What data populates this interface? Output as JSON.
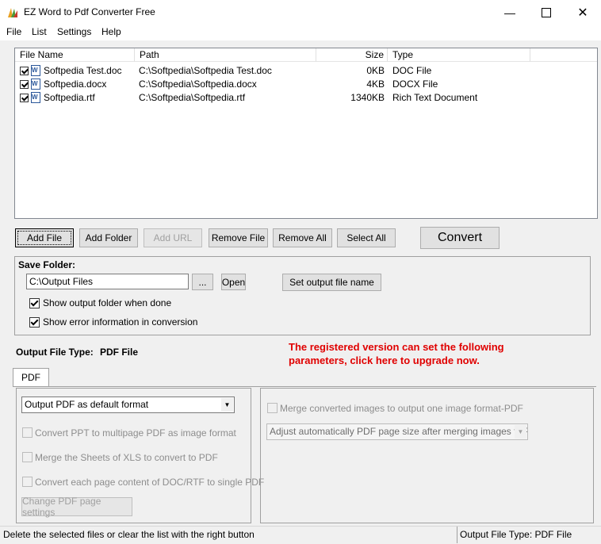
{
  "window": {
    "title": "EZ Word to Pdf Converter Free"
  },
  "menu": [
    "File",
    "List",
    "Settings",
    "Help"
  ],
  "file_list": {
    "columns": [
      "File Name",
      "Path",
      "Size",
      "Type"
    ],
    "rows": [
      {
        "name": "Softpedia Test.doc",
        "path": "C:\\Softpedia\\Softpedia Test.doc",
        "size": "0KB",
        "type": "DOC File",
        "checked": true
      },
      {
        "name": "Softpedia.docx",
        "path": "C:\\Softpedia\\Softpedia.docx",
        "size": "4KB",
        "type": "DOCX File",
        "checked": true
      },
      {
        "name": "Softpedia.rtf",
        "path": "C:\\Softpedia\\Softpedia.rtf",
        "size": "1340KB",
        "type": "Rich Text Document",
        "checked": true
      }
    ]
  },
  "buttons": {
    "add_file": "Add File",
    "add_folder": "Add Folder",
    "add_url": "Add URL",
    "remove_file": "Remove File",
    "remove_all": "Remove All",
    "select_all": "Select All",
    "convert": "Convert"
  },
  "save_folder": {
    "label": "Save Folder:",
    "path": "C:\\Output Files",
    "browse": "...",
    "open": "Open",
    "set_name": "Set output file name",
    "show_output": "Show output folder when done",
    "show_error": "Show error information in conversion"
  },
  "output_type": {
    "label": "Output File Type:",
    "value": "PDF File",
    "upgrade_line1": "The registered version can set the following",
    "upgrade_line2": "parameters, click here to upgrade now."
  },
  "tab": {
    "label": "PDF"
  },
  "pdf_options": {
    "format_select": "Output PDF as default format",
    "opt_ppt": "Convert PPT to multipage PDF as image format",
    "opt_xls": "Merge the Sheets of XLS to convert to PDF",
    "opt_doc": "Convert each page content of DOC/RTF to single PDF",
    "page_settings": "Change PDF page settings",
    "merge_images": "Merge converted images to output one image format-PDF",
    "adjust_select": "Adjust automatically PDF page size after merging images to PDF"
  },
  "status": {
    "left": "Delete the selected files or clear the list with the right button",
    "right": "Output File Type:  PDF File"
  }
}
